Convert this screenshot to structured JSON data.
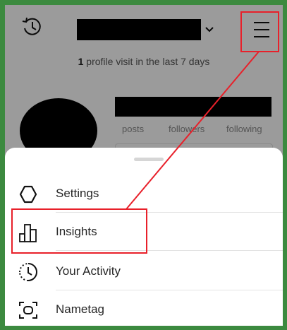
{
  "profile": {
    "visits_count": "1",
    "visits_text": " profile visit in the last 7 days",
    "stats": [
      "posts",
      "followers",
      "following"
    ]
  },
  "menu": {
    "items": [
      {
        "label": "Settings",
        "icon": "gear-icon"
      },
      {
        "label": "Insights",
        "icon": "bar-chart-icon"
      },
      {
        "label": "Your Activity",
        "icon": "activity-icon"
      },
      {
        "label": "Nametag",
        "icon": "nametag-icon"
      }
    ]
  },
  "colors": {
    "highlight": "#e8202a",
    "frame": "#3c8a3f"
  }
}
